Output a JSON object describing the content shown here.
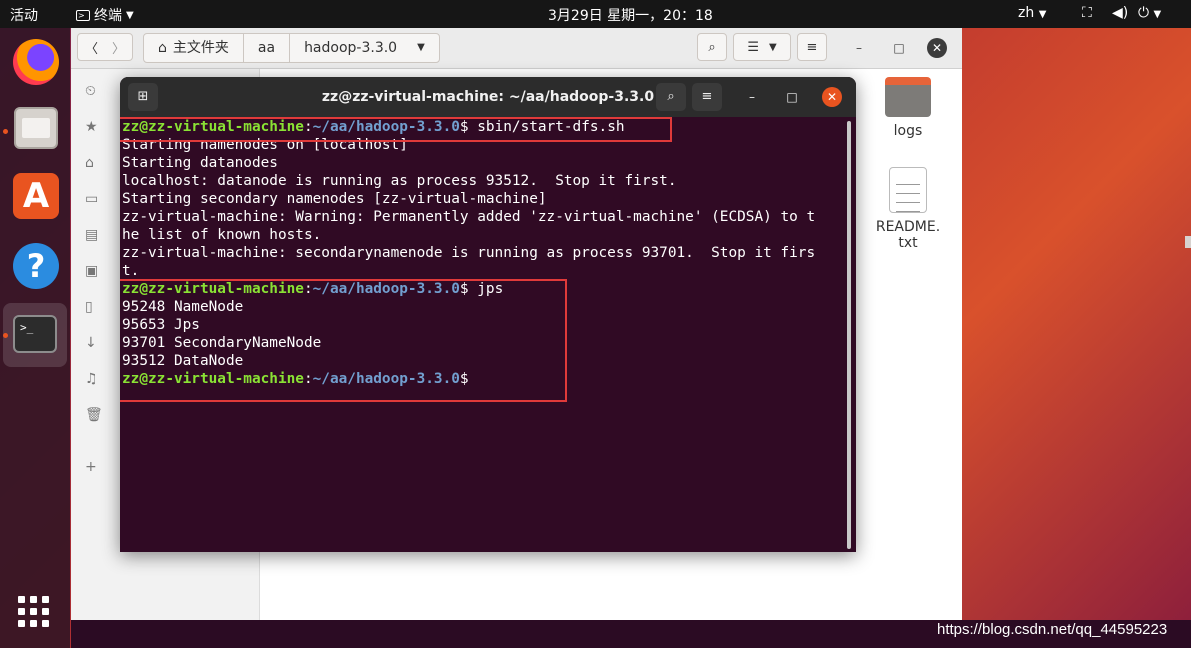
{
  "topbar": {
    "activities": "活动",
    "app_name": "终端",
    "clock": "3月29日 星期一，20：18",
    "language": "zh"
  },
  "file_manager": {
    "breadcrumbs": [
      "主文件夹",
      "aa",
      "hadoop-3.3.0"
    ],
    "files": [
      {
        "name": "logs",
        "icon": "folder-icon"
      },
      {
        "name": "README.",
        "name2": "txt",
        "icon": "text-file-icon"
      }
    ]
  },
  "terminal": {
    "title": "zz@zz-virtual-machine: ~/aa/hadoop-3.3.0",
    "prompt_user": "zz@zz-virtual-machine",
    "prompt_path": "~/aa/hadoop-3.3.0",
    "lines": [
      {
        "prompt": true,
        "cmd": " sbin/start-dfs.sh"
      },
      {
        "text": "Starting namenodes on [localhost]"
      },
      {
        "text": "Starting datanodes"
      },
      {
        "text": "localhost: datanode is running as process 93512.  Stop it first."
      },
      {
        "text": "Starting secondary namenodes [zz-virtual-machine]"
      },
      {
        "text": "zz-virtual-machine: Warning: Permanently added 'zz-virtual-machine' (ECDSA) to t"
      },
      {
        "text": "he list of known hosts."
      },
      {
        "text": "zz-virtual-machine: secondarynamenode is running as process 93701.  Stop it firs"
      },
      {
        "text": "t."
      },
      {
        "prompt": true,
        "cmd": " jps"
      },
      {
        "text": "95248 NameNode"
      },
      {
        "text": "95653 Jps"
      },
      {
        "text": "93701 SecondaryNameNode"
      },
      {
        "text": "93512 DataNode"
      },
      {
        "prompt": true,
        "cmd": ""
      }
    ]
  },
  "watermark": "https://blog.csdn.net/qq_44595223",
  "colors": {
    "terminal_bg": "#300a24",
    "prompt_user": "#8ae234",
    "prompt_path": "#729fcf",
    "highlight_box": "#e03a3a",
    "accent": "#e95420"
  }
}
